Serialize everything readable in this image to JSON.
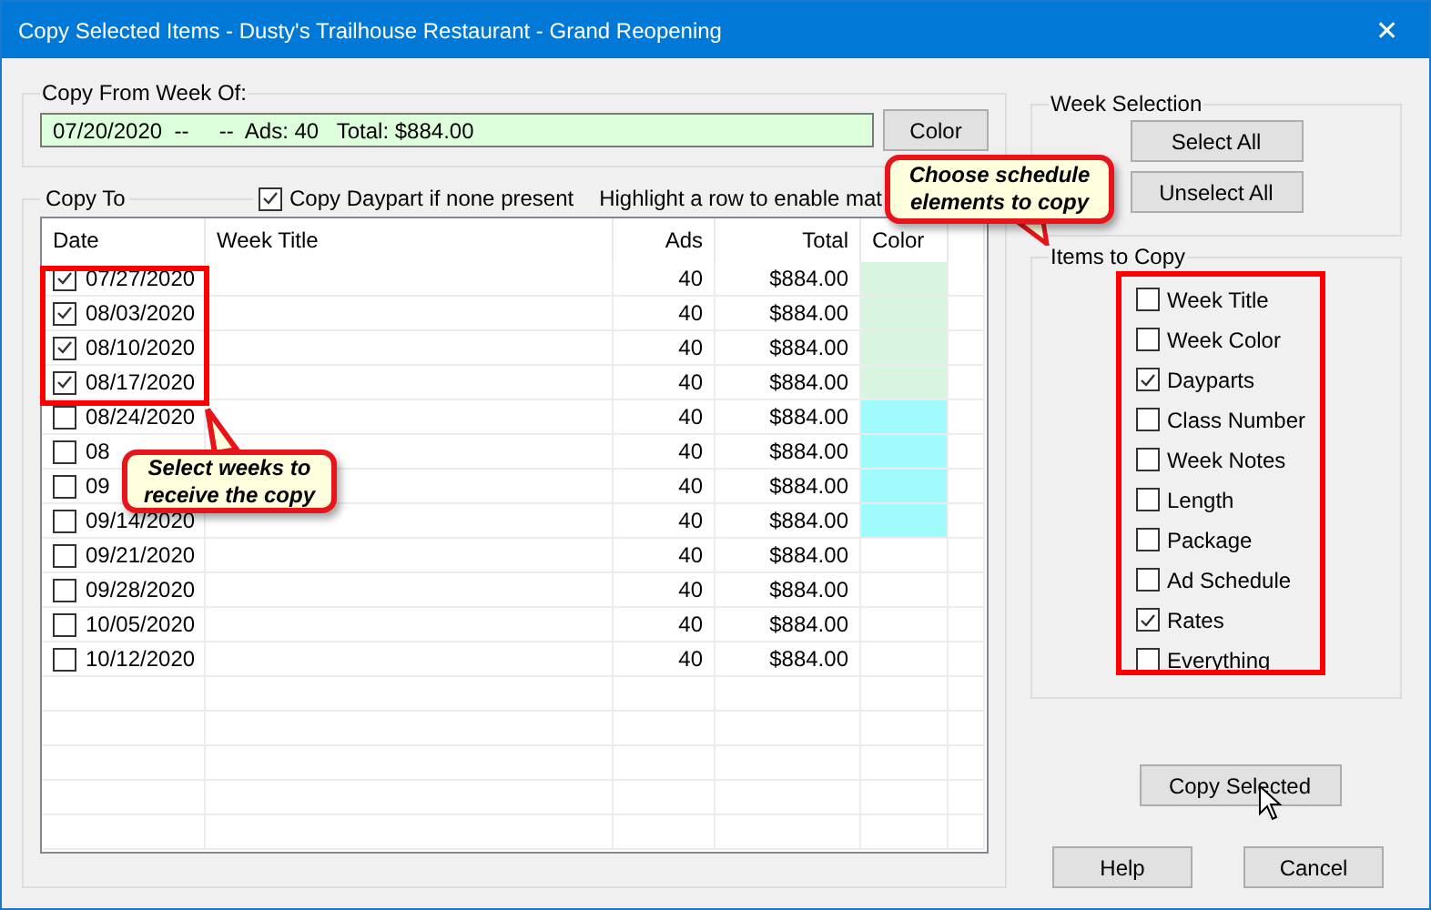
{
  "window": {
    "title": "Copy Selected Items - Dusty's Trailhouse Restaurant - Grand Reopening",
    "close": "✕"
  },
  "copy_from": {
    "legend": "Copy From Week Of:",
    "value": "07/20/2020  --     --  Ads: 40   Total: $884.00",
    "color_button": "Color"
  },
  "copy_to": {
    "legend": "Copy To",
    "daypart_option": {
      "label": "Copy Daypart if none present",
      "checked": true
    },
    "hint": "Highlight a row to enable mat"
  },
  "table": {
    "columns": [
      "Date",
      "Week Title",
      "Ads",
      "Total",
      "Color"
    ],
    "rows": [
      {
        "date": "07/27/2020",
        "checked": true,
        "ads": "40",
        "total": "$884.00",
        "color": "#d8f5df"
      },
      {
        "date": "08/03/2020",
        "checked": true,
        "ads": "40",
        "total": "$884.00",
        "color": "#d8f5df"
      },
      {
        "date": "08/10/2020",
        "checked": true,
        "ads": "40",
        "total": "$884.00",
        "color": "#d8f5df"
      },
      {
        "date": "08/17/2020",
        "checked": true,
        "ads": "40",
        "total": "$884.00",
        "color": "#d8f5df"
      },
      {
        "date": "08/24/2020",
        "checked": false,
        "ads": "40",
        "total": "$884.00",
        "color": "#a0fbfd"
      },
      {
        "date": "08",
        "checked": false,
        "ads": "40",
        "total": "$884.00",
        "color": "#a0fbfd"
      },
      {
        "date": "09",
        "checked": false,
        "ads": "40",
        "total": "$884.00",
        "color": "#a0fbfd"
      },
      {
        "date": "09/14/2020",
        "checked": false,
        "ads": "40",
        "total": "$884.00",
        "color": "#a0fbfd"
      },
      {
        "date": "09/21/2020",
        "checked": false,
        "ads": "40",
        "total": "$884.00"
      },
      {
        "date": "09/28/2020",
        "checked": false,
        "ads": "40",
        "total": "$884.00"
      },
      {
        "date": "10/05/2020",
        "checked": false,
        "ads": "40",
        "total": "$884.00"
      },
      {
        "date": "10/12/2020",
        "checked": false,
        "ads": "40",
        "total": "$884.00"
      }
    ]
  },
  "week_selection": {
    "legend": "Week Selection",
    "buttons": [
      "Select All",
      "Unselect All"
    ]
  },
  "items_to_copy": {
    "legend": "Items to Copy",
    "items": [
      {
        "label": "Week Title",
        "checked": false
      },
      {
        "label": "Week Color",
        "checked": false
      },
      {
        "label": "Dayparts",
        "checked": true
      },
      {
        "label": "Class Number",
        "checked": false
      },
      {
        "label": "Week Notes",
        "checked": false
      },
      {
        "label": "Length",
        "checked": false
      },
      {
        "label": "Package",
        "checked": false
      },
      {
        "label": "Ad Schedule",
        "checked": false
      },
      {
        "label": "Rates",
        "checked": true
      },
      {
        "label": "Everything",
        "checked": false
      }
    ]
  },
  "copy_button": "Copy Selected",
  "buttons": [
    "Help",
    "Cancel"
  ],
  "callouts": [
    "Select weeks to receive the copy",
    "Choose schedule elements to copy"
  ]
}
